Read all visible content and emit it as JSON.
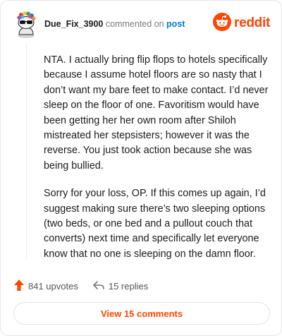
{
  "header": {
    "username": "Due_Fix_3900",
    "commented_text": "commented on",
    "post_link": "post",
    "brand": "reddit",
    "brand_color": "#ff4500",
    "avatar_icon": "snoo-avatar-icon",
    "logo_icon": "reddit-alien-icon"
  },
  "comment": {
    "paragraphs": [
      "NTA. I actually bring flip flops to hotels specifically because I assume hotel floors are so nasty that I don’t want my bare feet to make contact. I’d never sleep on the floor of one. Favoritism would have been getting her her own room after Shiloh mistreated her stepsisters; however it was the reverse. You just took action because she was being bullied.",
      "Sorry for your loss, OP. If this comes up again, I’d suggest making sure there’s two sleeping options (two beds, or one bed and a pullout couch that converts) next time and specifically let everyone know that no one is sleeping on the damn floor."
    ]
  },
  "actions": {
    "upvotes": "841 upvotes",
    "upvote_icon": "upvote-arrow-icon",
    "replies": "15 replies",
    "reply_icon": "reply-arrow-icon"
  },
  "footer": {
    "view_comments": "View 15 comments"
  }
}
